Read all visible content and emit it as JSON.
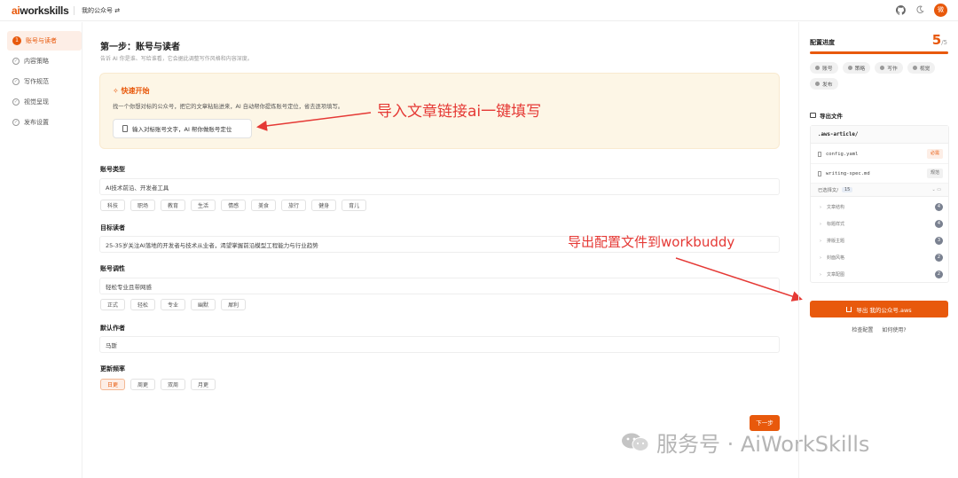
{
  "app": {
    "logo_prefix": "ai",
    "logo_suffix": "workskills",
    "account_switch": "我的公众号 ⇄",
    "avatar": "微"
  },
  "sidebar": {
    "items": [
      {
        "num": "1",
        "label": "账号与读者"
      },
      {
        "label": "内容策略"
      },
      {
        "label": "写作规范"
      },
      {
        "label": "视觉呈现"
      },
      {
        "label": "发布设置"
      }
    ]
  },
  "main": {
    "step_title": "第一步：账号与读者",
    "step_sub": "告诉 AI 你是谁、写给谁看，它会据此调整写作风格和内容深度。",
    "quick": {
      "title": "快速开始",
      "desc": "找一个你想对标的公众号，把它的文章粘贴进来，AI 自动帮你提炼账号定位，省去逐项填写。",
      "button": "输入对标账号文字，AI 帮你做账号定位"
    },
    "account_type": {
      "label": "账号类型",
      "value": "AI技术前沿、开发者工具",
      "tags": [
        "科技",
        "职场",
        "教育",
        "生活",
        "情感",
        "美食",
        "旅行",
        "健身",
        "育儿"
      ]
    },
    "target_readers": {
      "label": "目标读者",
      "value": "25-35岁关注AI落地的开发者与技术从业者，渴望掌握前沿模型工程能力与行业趋势"
    },
    "tone": {
      "label": "账号调性",
      "value": "轻松专业且带网感",
      "tags": [
        "正式",
        "轻松",
        "专业",
        "幽默",
        "犀利"
      ]
    },
    "author": {
      "label": "默认作者",
      "value": "马斯"
    },
    "frequency": {
      "label": "更新频率",
      "tags": [
        "日更",
        "周更",
        "双周",
        "月更"
      ],
      "selected": 0
    },
    "next_button": "下一步"
  },
  "annotations": {
    "import_note": "导入文章链接ai一键填写",
    "export_note": "导出配置文件到workbuddy"
  },
  "watermark": {
    "text": "服务号 · AiWorkSkills"
  },
  "right_panel": {
    "progress_title": "配置进度",
    "progress_done": "5",
    "progress_total": "/5",
    "progress_fraction": 1.0,
    "chips": [
      "账号",
      "策略",
      "写作",
      "视觉",
      "发布"
    ],
    "export_title": "导出文件",
    "root_dir": ".aws-article/",
    "files": [
      {
        "name": "config.yaml",
        "badge": "必需"
      },
      {
        "name": "writing-spec.md",
        "badge": "规范"
      }
    ],
    "selected_label": "已选择文/",
    "selected_count": "15",
    "sub_items": [
      {
        "label": "文章结构",
        "count": "4"
      },
      {
        "label": "标题样式",
        "count": "4"
      },
      {
        "label": "排版主题",
        "count": "3"
      },
      {
        "label": "封面风格",
        "count": "2"
      },
      {
        "label": "文章配图",
        "count": "2"
      }
    ],
    "export_button": "导出 我的公众号.aws",
    "link_check": "检查配置",
    "link_howto": "如何使用?"
  },
  "colors": {
    "accent": "#e8590c",
    "annotation": "#e53935",
    "quick_bg": "#fdf6e6"
  }
}
